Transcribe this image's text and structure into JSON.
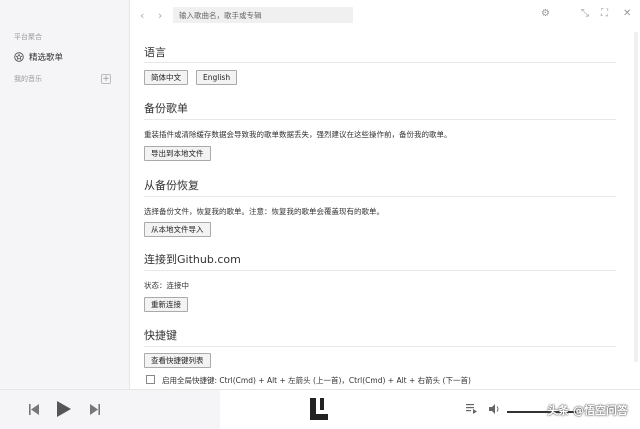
{
  "sidebar": {
    "group_platform": "平台聚合",
    "featured_playlist": "精选歌单",
    "group_my_music": "我的音乐",
    "add_symbol": "+"
  },
  "topbar": {
    "back": "‹",
    "forward": "›",
    "search_placeholder": "输入歌曲名，歌手或专辑",
    "settings_icon": "⚙",
    "minimize_icon": "⤡",
    "maximize_icon": "⛶",
    "close_icon": "✕"
  },
  "settings": {
    "language": {
      "title": "语言",
      "options": [
        "简体中文",
        "English"
      ]
    },
    "backup": {
      "title": "备份歌单",
      "description": "重装插件或清除缓存数据会导致我的歌单数据丢失，强烈建议在这些操作前，备份我的歌单。",
      "button": "导出到本地文件"
    },
    "restore": {
      "title": "从备份恢复",
      "description": "选择备份文件，恢复我的歌单。注意：恢复我的歌单会覆盖现有的歌单。",
      "button": "从本地文件导入"
    },
    "github": {
      "title": "连接到Github.com",
      "status": "状态：连接中",
      "button": "重新连接"
    },
    "shortcuts": {
      "title": "快捷键",
      "button": "查看快捷键列表",
      "global_label": "启用全局快捷键: Ctrl(Cmd) + Alt + 左箭头 (上一首)，Ctrl(Cmd) + Alt + 右箭头 (下一首)"
    }
  },
  "player": {
    "watermark": "头条 @悟空问答"
  }
}
